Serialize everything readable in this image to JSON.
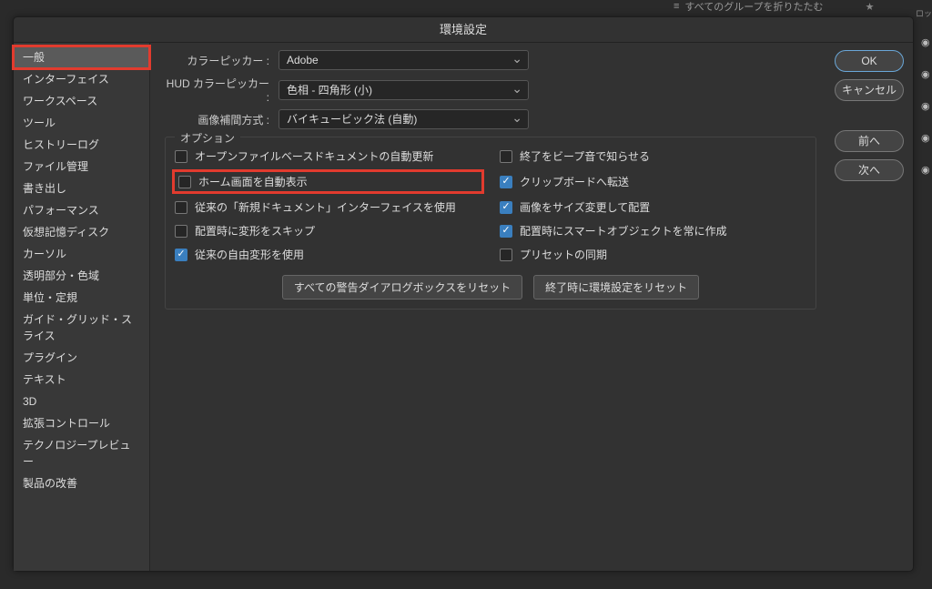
{
  "topbar": {
    "collapse_label": "すべてのグループを折りたたむ",
    "side_label": "ロッ"
  },
  "dialog": {
    "title": "環境設定"
  },
  "sidebar": {
    "items": [
      "一般",
      "インターフェイス",
      "ワークスペース",
      "ツール",
      "ヒストリーログ",
      "ファイル管理",
      "書き出し",
      "パフォーマンス",
      "仮想記憶ディスク",
      "カーソル",
      "透明部分・色域",
      "単位・定規",
      "ガイド・グリッド・スライス",
      "プラグイン",
      "テキスト",
      "3D",
      "拡張コントロール",
      "テクノロジープレビュー",
      "製品の改善"
    ],
    "selected_index": 0
  },
  "pickers": {
    "color_picker_label": "カラーピッカー :",
    "color_picker_value": "Adobe",
    "hud_label": "HUD カラーピッカー :",
    "hud_value": "色相 - 四角形 (小)",
    "interp_label": "画像補間方式 :",
    "interp_value": "バイキュービック法 (自動)"
  },
  "options": {
    "legend": "オプション",
    "left": [
      {
        "label": "オープンファイルベースドキュメントの自動更新",
        "checked": false,
        "highlighted": false
      },
      {
        "label": "ホーム画面を自動表示",
        "checked": false,
        "highlighted": true
      },
      {
        "label": "従来の「新規ドキュメント」インターフェイスを使用",
        "checked": false,
        "highlighted": false
      },
      {
        "label": "配置時に変形をスキップ",
        "checked": false,
        "highlighted": false
      },
      {
        "label": "従来の自由変形を使用",
        "checked": true,
        "highlighted": false
      }
    ],
    "right": [
      {
        "label": "終了をビープ音で知らせる",
        "checked": false
      },
      {
        "label": "クリップボードへ転送",
        "checked": true
      },
      {
        "label": "画像をサイズ変更して配置",
        "checked": true
      },
      {
        "label": "配置時にスマートオブジェクトを常に作成",
        "checked": true
      },
      {
        "label": "プリセットの同期",
        "checked": false
      }
    ],
    "reset_all_warnings": "すべての警告ダイアログボックスをリセット",
    "reset_on_quit": "終了時に環境設定をリセット"
  },
  "buttons": {
    "ok": "OK",
    "cancel": "キャンセル",
    "prev": "前へ",
    "next": "次へ"
  },
  "icons": {
    "hamburger": "≡",
    "star": "★",
    "eye": "◉"
  }
}
